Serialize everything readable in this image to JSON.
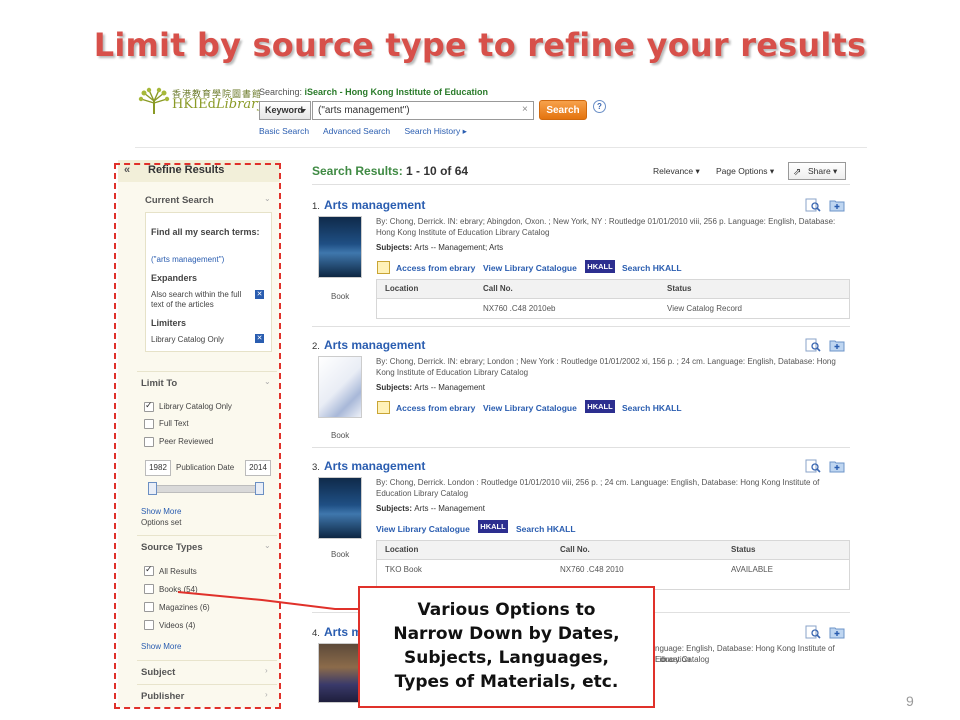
{
  "slide": {
    "title": "Limit by source type to refine your results",
    "page_number": "9",
    "callout": [
      "Various Options to",
      "Narrow Down by Dates,",
      "Subjects, Languages,",
      "Types of Materials, etc."
    ]
  },
  "header": {
    "logo_cn": "香港教育學院圖書館",
    "logo_en_prefix": "HKIEd",
    "logo_en_suffix": "Library",
    "searching_label": "Searching:",
    "searching_target": "iSearch - Hong Kong Institute of Education",
    "field_select": "Keyword",
    "query": "(\"arts management\")",
    "search_button": "Search",
    "help": "?",
    "links": [
      "Basic Search",
      "Advanced Search",
      "Search History ▸"
    ]
  },
  "refine": {
    "collapse": "«",
    "title": "Refine Results",
    "current_search": {
      "title": "Current Search",
      "find_all_label": "Find all my search terms:",
      "terms": "(\"arts management\")",
      "expanders_title": "Expanders",
      "expander_item": "Also search within the full text of the articles",
      "limiters_title": "Limiters",
      "limiter_item": "Library Catalog Only"
    },
    "limit_to": {
      "title": "Limit To",
      "options": [
        {
          "label": "Library Catalog Only",
          "checked": true
        },
        {
          "label": "Full Text",
          "checked": false
        },
        {
          "label": "Peer Reviewed",
          "checked": false
        }
      ],
      "pub_date_from": "1982",
      "pub_date_label": "Publication Date",
      "pub_date_to": "2014",
      "show_more": "Show More",
      "options_set": "Options set"
    },
    "source_types": {
      "title": "Source Types",
      "options": [
        {
          "label": "All Results",
          "count": "",
          "checked": true
        },
        {
          "label": "Books",
          "count": "(54)",
          "checked": false
        },
        {
          "label": "Magazines",
          "count": "(6)",
          "checked": false
        },
        {
          "label": "Videos",
          "count": "(4)",
          "checked": false
        }
      ],
      "show_more": "Show More"
    },
    "subject": "Subject",
    "publisher": "Publisher"
  },
  "results": {
    "label": "Search Results:",
    "range": "1 - 10 of 64",
    "relevance": "Relevance",
    "page_options": "Page Options",
    "share": "Share",
    "items": [
      {
        "num": "1.",
        "title": "Arts management",
        "meta": "By: Chong, Derrick. IN: ebrary; Abingdon, Oxon. ; New York, NY : Routledge 01/01/2010 viii, 256 p. Language: English, Database: Hong Kong Institute of Education Library Catalog",
        "subjects_label": "Subjects:",
        "subjects": "Arts -- Management; Arts",
        "type": "Book",
        "links": [
          "Access from ebrary",
          "View Library Catalogue",
          "HKALL",
          "Search HKALL"
        ],
        "table": {
          "headers": [
            "Location",
            "Call No.",
            "Status"
          ],
          "row": [
            "",
            "NX760 .C48 2010eb",
            "View Catalog Record"
          ]
        }
      },
      {
        "num": "2.",
        "title": "Arts management",
        "meta": "By: Chong, Derrick. IN: ebrary; London ; New York : Routledge 01/01/2002 xi, 156 p. ; 24 cm. Language: English, Database: Hong Kong Institute of Education Library Catalog",
        "subjects_label": "Subjects:",
        "subjects": "Arts -- Management",
        "type": "Book",
        "links": [
          "Access from ebrary",
          "View Library Catalogue",
          "HKALL",
          "Search HKALL"
        ]
      },
      {
        "num": "3.",
        "title": "Arts management",
        "meta": "By: Chong, Derrick. London : Routledge 01/01/2010 viii, 256 p. ; 24 cm. Language: English, Database: Hong Kong Institute of Education Library Catalog",
        "subjects_label": "Subjects:",
        "subjects": "Arts -- Management",
        "type": "Book",
        "links": [
          "View Library Catalogue",
          "HKALL",
          "Search HKALL"
        ],
        "table": {
          "headers": [
            "Location",
            "Call No.",
            "Status"
          ],
          "row": [
            "TKO Book",
            "NX760 .C48 2010",
            "AVAILABLE"
          ]
        }
      },
      {
        "num": "4.",
        "title": "Arts m",
        "meta": "nguage: English, Database: Hong Kong Institute of Education",
        "meta2": "Library Catalog"
      }
    ]
  },
  "colors": {
    "title_red": "#d7504a",
    "frame_red": "#e0312a",
    "result_link": "#2a5db0",
    "results_green": "#3f8a43",
    "search_orange": "#e4740f",
    "hkall_navy": "#2c2e8f"
  }
}
